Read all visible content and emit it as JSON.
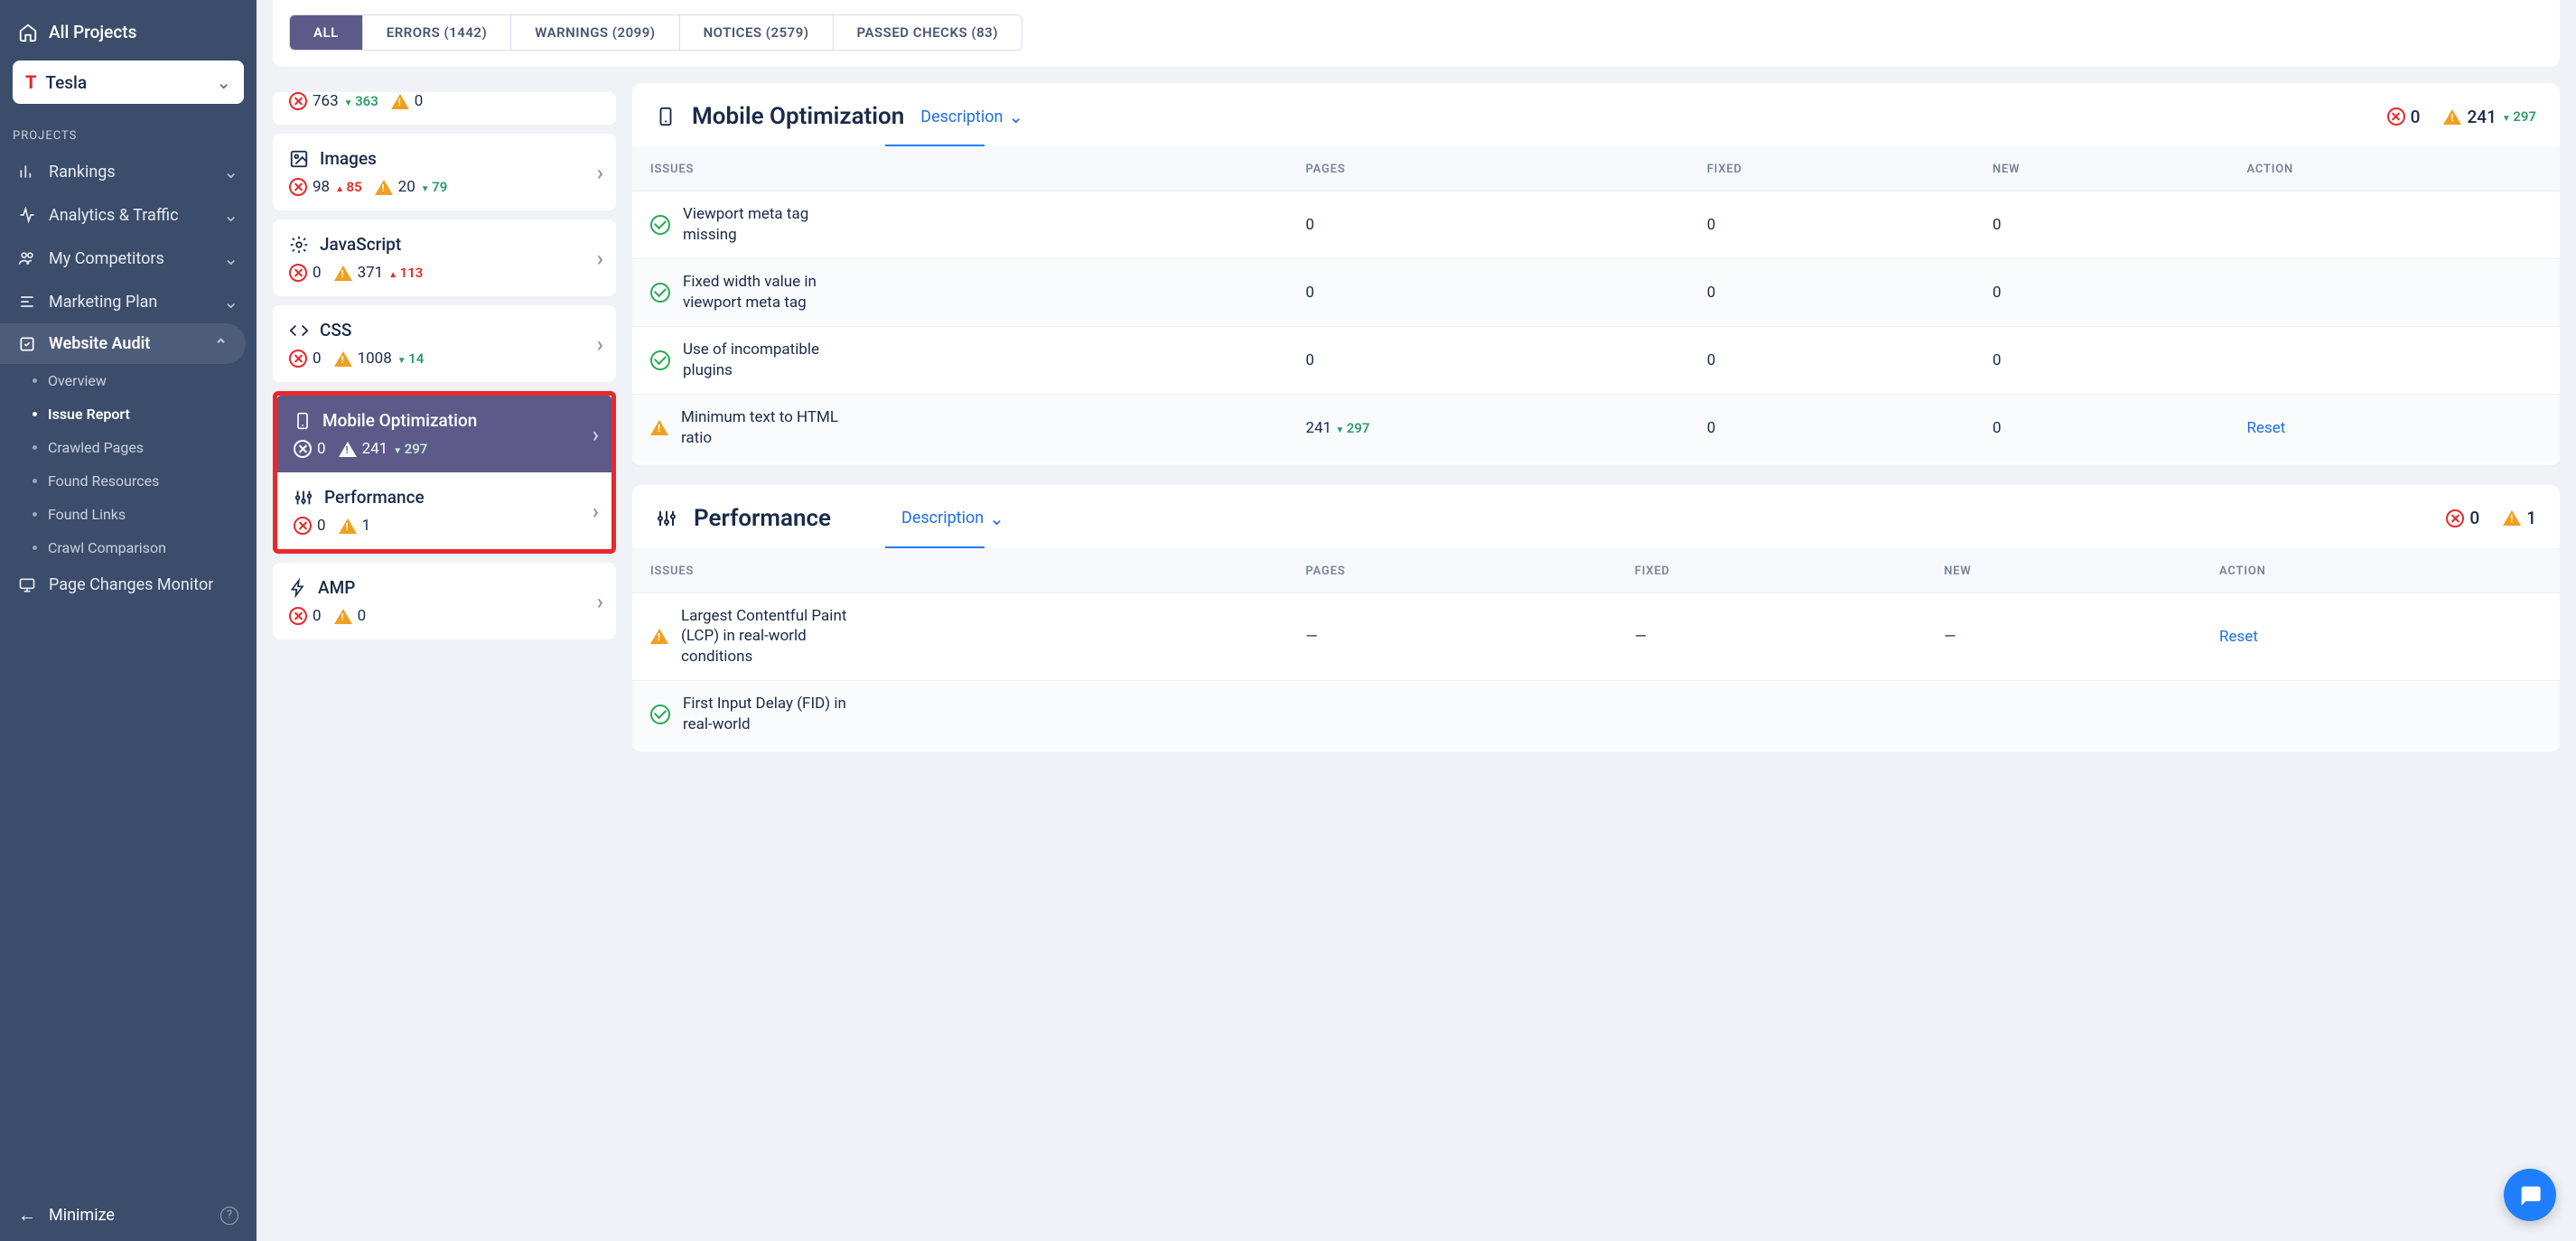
{
  "sidebar": {
    "all_projects": "All Projects",
    "current_project": "Tesla",
    "section_label": "PROJECTS",
    "items": [
      {
        "label": "Rankings"
      },
      {
        "label": "Analytics & Traffic"
      },
      {
        "label": "My Competitors"
      },
      {
        "label": "Marketing Plan"
      },
      {
        "label": "Website Audit"
      }
    ],
    "audit_subitems": [
      {
        "label": "Overview"
      },
      {
        "label": "Issue Report"
      },
      {
        "label": "Crawled Pages"
      },
      {
        "label": "Found Resources"
      },
      {
        "label": "Found Links"
      },
      {
        "label": "Crawl Comparison"
      }
    ],
    "page_changes": "Page Changes Monitor",
    "minimize": "Minimize"
  },
  "tabs": [
    {
      "label": "ALL"
    },
    {
      "label": "ERRORS (1442)"
    },
    {
      "label": "WARNINGS (2099)"
    },
    {
      "label": "NOTICES (2579)"
    },
    {
      "label": "PASSED CHECKS (83)"
    }
  ],
  "categories": {
    "partial": {
      "err": "763",
      "err_delta": "363",
      "warn": "0"
    },
    "images": {
      "title": "Images",
      "err": "98",
      "err_delta": "85",
      "warn": "20",
      "warn_delta": "79"
    },
    "javascript": {
      "title": "JavaScript",
      "err": "0",
      "warn": "371",
      "warn_delta": "113"
    },
    "css": {
      "title": "CSS",
      "err": "0",
      "warn": "1008",
      "warn_delta": "14"
    },
    "mobile": {
      "title": "Mobile Optimization",
      "err": "0",
      "warn": "241",
      "warn_delta": "297"
    },
    "performance": {
      "title": "Performance",
      "err": "0",
      "warn": "1"
    },
    "amp": {
      "title": "AMP",
      "err": "0",
      "warn": "0"
    }
  },
  "detail": {
    "mobile": {
      "title": "Mobile Optimization",
      "description_label": "Description",
      "err": "0",
      "warn": "241",
      "warn_delta": "297",
      "headers": {
        "issues": "ISSUES",
        "pages": "PAGES",
        "fixed": "FIXED",
        "new": "NEW",
        "action": "ACTION"
      },
      "rows": [
        {
          "status": "ok",
          "name": "Viewport meta tag missing",
          "pages": "0",
          "fixed": "0",
          "new": "0",
          "action": ""
        },
        {
          "status": "ok",
          "name": "Fixed width value in viewport meta tag",
          "pages": "0",
          "fixed": "0",
          "new": "0",
          "action": ""
        },
        {
          "status": "ok",
          "name": "Use of incompatible plugins",
          "pages": "0",
          "fixed": "0",
          "new": "0",
          "action": ""
        },
        {
          "status": "warn",
          "name": "Minimum text to HTML ratio",
          "pages": "241",
          "pages_delta": "297",
          "fixed": "0",
          "new": "0",
          "action": "Reset"
        }
      ]
    },
    "performance": {
      "title": "Performance",
      "description_label": "Description",
      "err": "0",
      "warn": "1",
      "headers": {
        "issues": "ISSUES",
        "pages": "PAGES",
        "fixed": "FIXED",
        "new": "NEW",
        "action": "ACTION"
      },
      "rows": [
        {
          "status": "warn",
          "name": "Largest Contentful Paint (LCP) in real-world conditions",
          "pages": "—",
          "fixed": "—",
          "new": "—",
          "action": "Reset"
        },
        {
          "status": "ok",
          "name": "First Input Delay (FID) in real-world",
          "pages": "",
          "fixed": "",
          "new": "",
          "action": ""
        }
      ]
    }
  }
}
